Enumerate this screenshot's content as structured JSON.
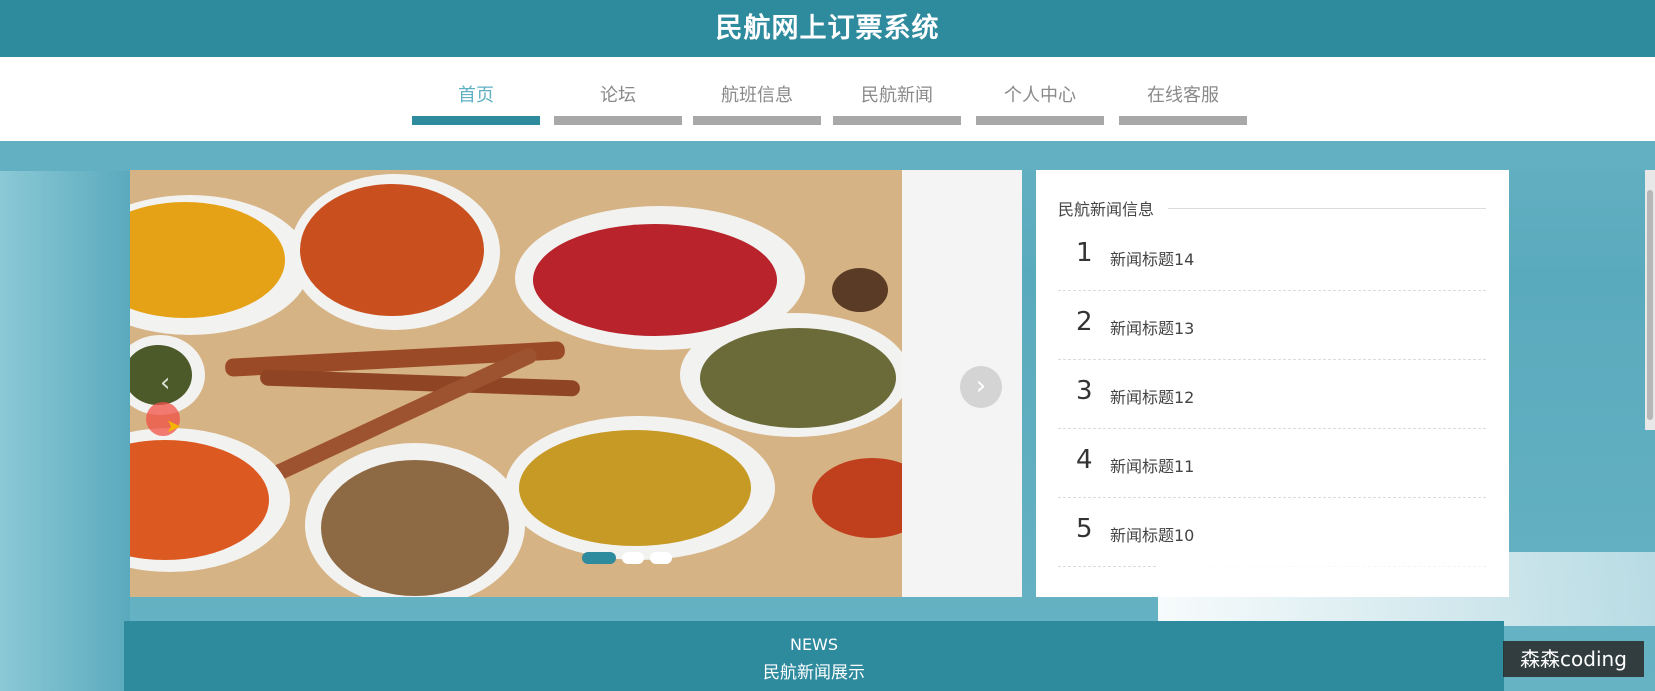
{
  "header": {
    "title": "民航网上订票系统"
  },
  "nav": {
    "items": [
      {
        "label": "首页",
        "active": true
      },
      {
        "label": "论坛",
        "active": false
      },
      {
        "label": "航班信息",
        "active": false
      },
      {
        "label": "民航新闻",
        "active": false
      },
      {
        "label": "个人中心",
        "active": false
      },
      {
        "label": "在线客服",
        "active": false
      }
    ]
  },
  "carousel": {
    "prev_icon": "chevron-left-icon",
    "next_icon": "chevron-right-icon",
    "slide_count": 3,
    "active_slide": 1
  },
  "news_panel": {
    "title": "民航新闻信息",
    "items": [
      {
        "num": "1",
        "title": "新闻标题14"
      },
      {
        "num": "2",
        "title": "新闻标题13"
      },
      {
        "num": "3",
        "title": "新闻标题12"
      },
      {
        "num": "4",
        "title": "新闻标题11"
      },
      {
        "num": "5",
        "title": "新闻标题10"
      }
    ]
  },
  "news_section": {
    "en": "NEWS",
    "cn": "民航新闻展示"
  },
  "watermark": {
    "text": "森森coding"
  },
  "colors": {
    "primary": "#2e8a9d",
    "accent": "#5fb1c3",
    "inactive_bar": "#a8a8a8"
  }
}
